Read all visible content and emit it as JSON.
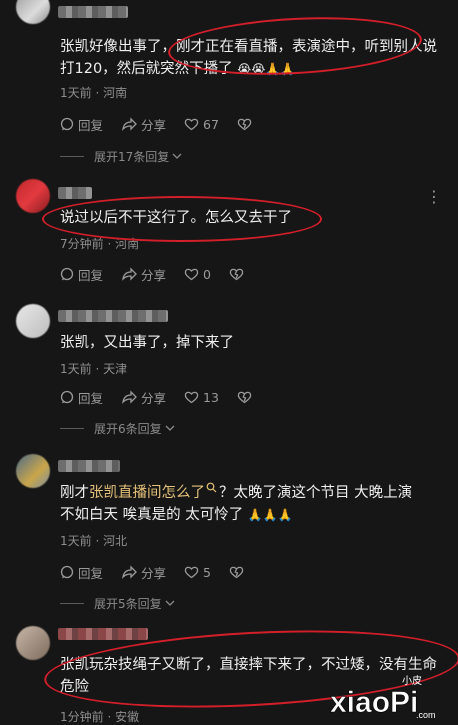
{
  "comments": [
    {
      "text": "张凯好像出事了，刚才正在看直播，表演途中，听到别人说打120，然后就突然下播了",
      "emoji": "😭😭🙏🙏",
      "meta": "1天前 · 河南",
      "reply_label": "回复",
      "share_label": "分享",
      "like_count": "67",
      "expand": "展开17条回复"
    },
    {
      "text": "说过以后不干这行了。怎么又去干了",
      "meta": "7分钟前 · 河南",
      "reply_label": "回复",
      "share_label": "分享",
      "like_count": "0"
    },
    {
      "text": "张凯，又出事了，掉下来了",
      "meta": "1天前 · 天津",
      "reply_label": "回复",
      "share_label": "分享",
      "like_count": "13",
      "expand": "展开6条回复"
    },
    {
      "text_prefix": "刚才",
      "text_link": "张凯直播间怎么了",
      "text_suffix": "？太晚了演这个节目 大晚上演不如白天 唉真是的 太可怜了",
      "emoji": "🙏🙏🙏",
      "meta": "1天前 · 河北",
      "reply_label": "回复",
      "share_label": "分享",
      "like_count": "5",
      "expand": "展开5条回复"
    },
    {
      "text": "张凯玩杂技绳子又断了，直接摔下来了，不过矮，没有生命危险",
      "meta": "1分钟前 · 安徽"
    }
  ],
  "watermark": {
    "small": "小皮",
    "brand": "xiaoPi",
    "domain": ".com"
  },
  "colors": {
    "background": "#161616",
    "annotation": "#d21f2a",
    "link": "#e6c27a"
  }
}
